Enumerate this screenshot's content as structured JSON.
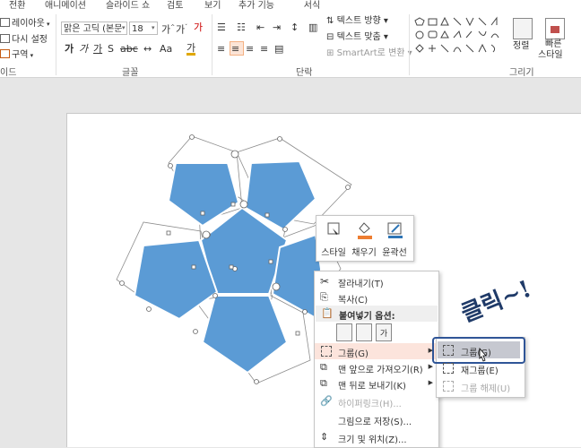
{
  "tabs": [
    "전환",
    "애니메이션",
    "슬라이드 쇼",
    "검토",
    "보기",
    "추가 기능",
    "서식"
  ],
  "ribbon": {
    "slides": {
      "layout": "레이아웃",
      "reset": "다시 설정",
      "section": "구역",
      "label": "이드"
    },
    "font": {
      "family": "맑은 고딕 (본문",
      "size": "18",
      "label": "글꼴"
    },
    "paragraph": {
      "text_direction": "텍스트 방향",
      "text_align": "텍스트 맞춤",
      "smartart": "SmartArt로 변환",
      "label": "단락"
    },
    "drawing": {
      "arrange": "정렬",
      "quick_styles": [
        "빠른",
        "스타일"
      ],
      "label": "그리기"
    }
  },
  "mini_toolbar": {
    "items": [
      "스타일",
      "채우기",
      "윤곽선"
    ]
  },
  "context_menu": {
    "items": [
      {
        "label": "잘라내기(T)",
        "icon": "scissors-icon",
        "disabled": false
      },
      {
        "label": "복사(C)",
        "icon": "copy-icon",
        "disabled": false
      },
      {
        "label": "붙여넣기 옵션:",
        "icon": "paste-icon",
        "header": true
      },
      {
        "label": "그룹(G)",
        "icon": "group-icon",
        "submenu": true,
        "highlighted": true
      },
      {
        "label": "맨 앞으로 가져오기(R)",
        "icon": "bring-front-icon",
        "submenu": true
      },
      {
        "label": "맨 뒤로 보내기(K)",
        "icon": "send-back-icon",
        "submenu": true
      },
      {
        "label": "하이퍼링크(H)...",
        "icon": "hyperlink-icon",
        "disabled": true
      },
      {
        "label": "그림으로 저장(S)...",
        "icon": "",
        "disabled": false
      },
      {
        "label": "크기 및 위치(Z)...",
        "icon": "size-position-icon",
        "disabled": false
      }
    ]
  },
  "submenu": {
    "items": [
      {
        "label": "그룹(G)",
        "highlighted": true
      },
      {
        "label": "재그룹(E)",
        "disabled": false
      },
      {
        "label": "그룹 해제(U)",
        "disabled": true
      }
    ]
  },
  "annotation": "클릭~!",
  "colors": {
    "accent": "#2b579a",
    "shape_fill": "#5b9bd5",
    "menu_hover": "#fce4dc",
    "callout": "#2f5597"
  }
}
